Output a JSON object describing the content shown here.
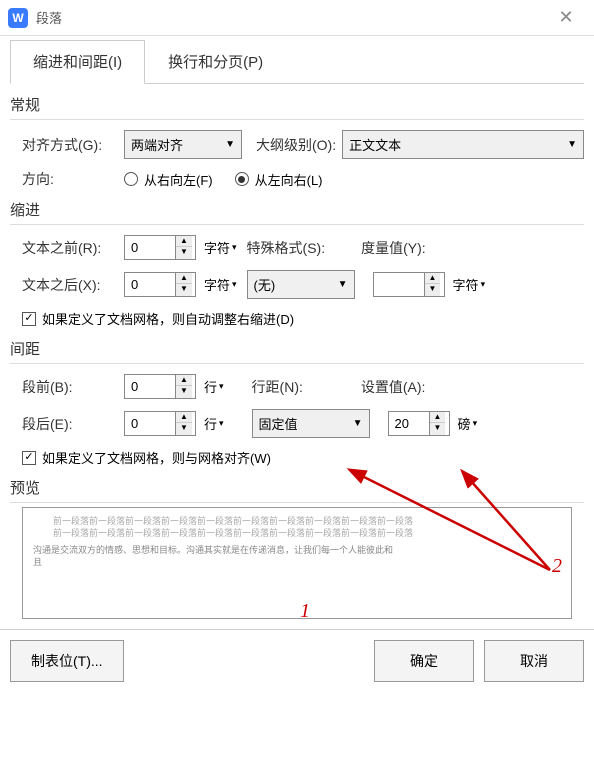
{
  "title": "段落",
  "tabs": {
    "indent": "缩进和间距(I)",
    "pagebreak": "换行和分页(P)"
  },
  "general": {
    "title": "常规",
    "align_label": "对齐方式(G):",
    "align_value": "两端对齐",
    "outline_label": "大纲级别(O):",
    "outline_value": "正文文本",
    "direction_label": "方向:",
    "rtl": "从右向左(F)",
    "ltr": "从左向右(L)"
  },
  "indent": {
    "title": "缩进",
    "before_label": "文本之前(R):",
    "before_value": "0",
    "after_label": "文本之后(X):",
    "after_value": "0",
    "unit_char": "字符",
    "special_label": "特殊格式(S):",
    "special_value": "(无)",
    "measure_label": "度量值(Y):",
    "measure_value": "",
    "measure_unit": "字符",
    "grid_check": "如果定义了文档网格，则自动调整右缩进(D)"
  },
  "spacing": {
    "title": "间距",
    "before_label": "段前(B):",
    "before_value": "0",
    "after_label": "段后(E):",
    "after_value": "0",
    "unit_line": "行",
    "linespacing_label": "行距(N):",
    "linespacing_value": "固定值",
    "setvalue_label": "设置值(A):",
    "setvalue_value": "20",
    "setvalue_unit": "磅",
    "grid_check": "如果定义了文档网格，则与网格对齐(W)"
  },
  "preview": {
    "title": "预览",
    "line1": "前一段落前一段落前一段落前一段落前一段落前一段落前一段落前一段落前一段落前一段落",
    "line2": "前一段落前一段落前一段落前一段落前一段落前一段落前一段落前一段落前一段落前一段落",
    "line3": "沟通是交流双方的情感、思想和目标。沟通其实就是在传递消息，让我们每一个人能彼此和"
  },
  "buttons": {
    "tabstop": "制表位(T)...",
    "ok": "确定",
    "cancel": "取消"
  },
  "annotations": {
    "n1": "1",
    "n2": "2"
  }
}
